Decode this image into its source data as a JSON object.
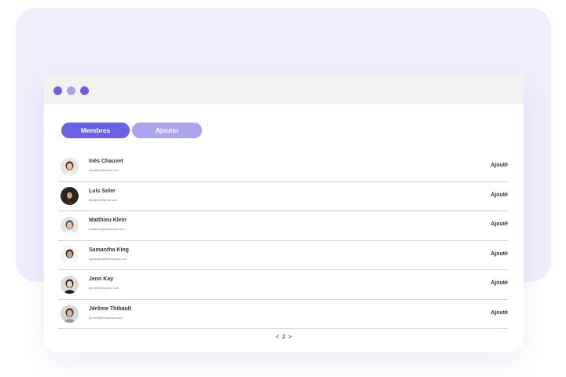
{
  "window": {
    "dots": [
      "red",
      "yellow",
      "green"
    ]
  },
  "tabs": [
    {
      "label": "Membres",
      "active": true
    },
    {
      "label": "Ajouter",
      "active": false
    }
  ],
  "members": [
    {
      "name": "Inès Chauvet",
      "email": "ines@entreprise.com",
      "status": "Ajouté",
      "avatar_bg": "#e9e3df",
      "hair": "#3a2a22",
      "skin": "#e8c3a8",
      "shirt": "#f1f1f1"
    },
    {
      "name": "Luis Soler",
      "email": "luis@entreprise.com",
      "status": "Ajouté",
      "avatar_bg": "#2c2522",
      "hair": "#1c1714",
      "skin": "#c99a7c",
      "shirt": "#3a2f29"
    },
    {
      "name": "Matthieu Klein",
      "email": "matthieu@entreprise.com",
      "status": "Ajouté",
      "avatar_bg": "#e6e6e6",
      "hair": "#5b4636",
      "skin": "#e6c2a6",
      "shirt": "#ffffff"
    },
    {
      "name": "Samantha King",
      "email": "samantha@entreprise.com",
      "status": "Ajouté",
      "avatar_bg": "#f4f4f4",
      "hair": "#2a1f19",
      "skin": "#caa184",
      "shirt": "#ffffff"
    },
    {
      "name": "Jenn Kay",
      "email": "jenn@entreprise.com",
      "status": "Ajouté",
      "avatar_bg": "#dcdcdc",
      "hair": "#1b1b1b",
      "skin": "#f0d2bd",
      "shirt": "#1a1a1a"
    },
    {
      "name": "Jérôme Thibault",
      "email": "jerome@entreprise.com",
      "status": "Ajouté",
      "avatar_bg": "#d7d7d7",
      "hair": "#2d2520",
      "skin": "#dcb597",
      "shirt": "#8e9aa7"
    }
  ],
  "pager": {
    "prev": "<",
    "page": "2",
    "next": ">"
  }
}
